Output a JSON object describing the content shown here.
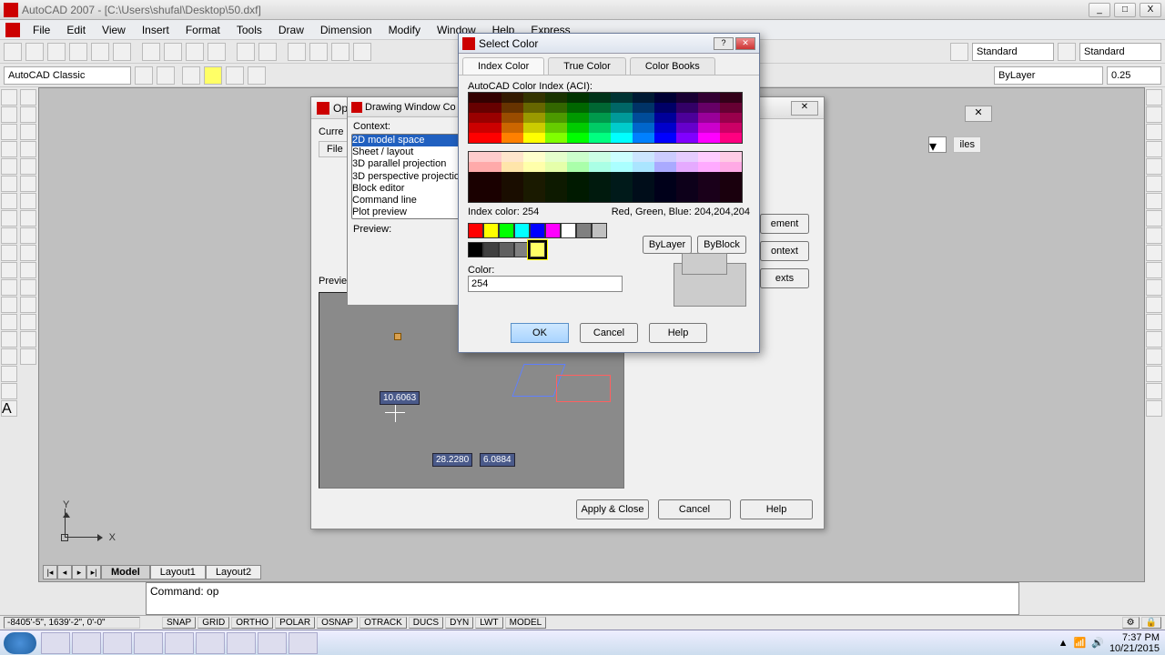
{
  "app": {
    "title": "AutoCAD 2007 - [C:\\Users\\shufal\\Desktop\\50.dxf]",
    "min": "_",
    "max": "□",
    "close": "X"
  },
  "menu": [
    "File",
    "Edit",
    "View",
    "Insert",
    "Format",
    "Tools",
    "Draw",
    "Dimension",
    "Modify",
    "Window",
    "Help",
    "Express"
  ],
  "workspace_combo": "AutoCAD Classic",
  "style_combo1": "Standard",
  "style_combo2": "Standard",
  "layer_combo": "ByLayer",
  "lw_combo": "0.25",
  "layout_tabs": {
    "model": "Model",
    "l1": "Layout1",
    "l2": "Layout2"
  },
  "command_line": "Command: op",
  "status": {
    "coords": "-8405'-5\", 1639'-2\", 0'-0\"",
    "buttons": [
      "SNAP",
      "GRID",
      "ORTHO",
      "POLAR",
      "OSNAP",
      "OTRACK",
      "DUCS",
      "DYN",
      "LWT",
      "MODEL"
    ]
  },
  "taskbar": {
    "time": "7:37 PM",
    "date": "10/21/2015"
  },
  "options": {
    "title": "Op",
    "current_label": "Curre",
    "file_tab": "File",
    "apply_close": "Apply & Close",
    "cancel": "Cancel",
    "help": "Help",
    "side_buttons": [
      "ement",
      "ontext",
      "exts"
    ],
    "profiles": "iles",
    "preview_label": "Preview:"
  },
  "dwc": {
    "title": "Drawing Window Co",
    "context_label": "Context:",
    "context_items": [
      "2D model space",
      "Sheet / layout",
      "3D parallel projection",
      "3D perspective projection",
      "Block editor",
      "Command line",
      "Plot preview"
    ]
  },
  "preview_dims": {
    "a": "10.6063",
    "b": "28.2280",
    "c": "6.0884"
  },
  "select_color": {
    "title": "Select Color",
    "tabs": [
      "Index Color",
      "True Color",
      "Color Books"
    ],
    "aci_label": "AutoCAD Color Index (ACI):",
    "index_label": "Index color:",
    "index_value": "254",
    "rgb_label": "Red, Green, Blue:",
    "rgb_value": "204,204,204",
    "color_label": "Color:",
    "color_value": "254",
    "bylayer": "ByLayer",
    "byblock": "ByBlock",
    "ok": "OK",
    "cancel": "Cancel",
    "help": "Help",
    "std_colors": [
      "#ff0000",
      "#ffff00",
      "#00ff00",
      "#00ffff",
      "#0000ff",
      "#ff00ff",
      "#ffffff",
      "#808080",
      "#c0c0c0"
    ],
    "gray_colors": [
      "#000000",
      "#404040",
      "#606060",
      "#808080",
      "#ffffff"
    ]
  }
}
